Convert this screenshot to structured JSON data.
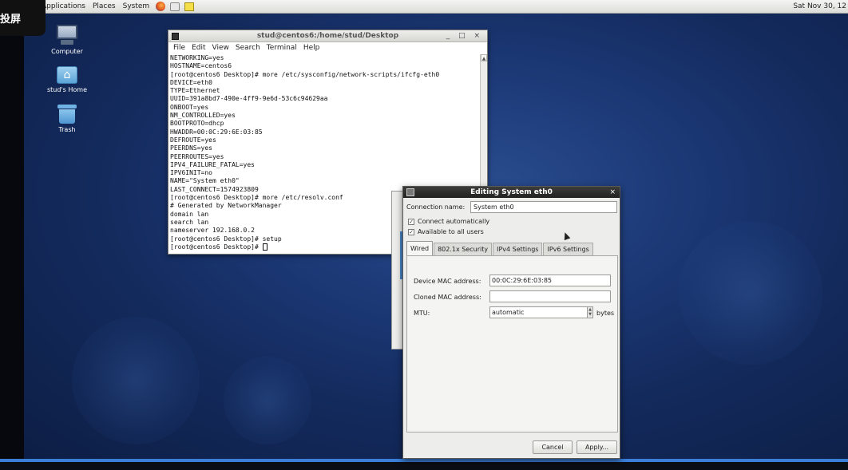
{
  "overlay": {
    "text": "投屏"
  },
  "top_panel": {
    "menus": [
      "Applications",
      "Places",
      "System"
    ],
    "launchers": [
      "firefox-icon",
      "mail-icon",
      "notes-icon"
    ],
    "clock": "Sat Nov 30, 12"
  },
  "desktop_icons": [
    {
      "label": "Computer",
      "icon": "computer-icon"
    },
    {
      "label": "stud's Home",
      "icon": "home-folder-icon"
    },
    {
      "label": "Trash",
      "icon": "trash-icon"
    }
  ],
  "terminal": {
    "title": "stud@centos6:/home/stud/Desktop",
    "window_controls": "_ □ ×",
    "menus": [
      "File",
      "Edit",
      "View",
      "Search",
      "Terminal",
      "Help"
    ],
    "lines": [
      "NETWORKING=yes",
      "HOSTNAME=centos6",
      "[root@centos6 Desktop]# more /etc/sysconfig/network-scripts/ifcfg-eth0",
      "DEVICE=eth0",
      "TYPE=Ethernet",
      "UUID=391a8bd7-490e-4ff9-9e6d-53c6c94629aa",
      "ONBOOT=yes",
      "NM_CONTROLLED=yes",
      "BOOTPROTO=dhcp",
      "HWADDR=00:0C:29:6E:03:85",
      "DEFROUTE=yes",
      "PEERDNS=yes",
      "PEERROUTES=yes",
      "IPV4_FAILURE_FATAL=yes",
      "IPV6INIT=no",
      "NAME=\"System eth0\"",
      "LAST_CONNECT=1574923809",
      "[root@centos6 Desktop]# more /etc/resolv.conf",
      "# Generated by NetworkManager",
      "domain lan",
      "search lan",
      "nameserver 192.168.0.2",
      "[root@centos6 Desktop]# setup"
    ],
    "prompt": "[root@centos6 Desktop]# "
  },
  "dialog": {
    "title": "Editing System eth0",
    "close": "×",
    "connection_name_label": "Connection name:",
    "connection_name_value": "System eth0",
    "connect_automatically": {
      "label": "Connect automatically",
      "checked": true
    },
    "available_to_all_users": {
      "label": "Available to all users",
      "checked": true
    },
    "tabs": [
      "Wired",
      "802.1x Security",
      "IPv4 Settings",
      "IPv6 Settings"
    ],
    "active_tab": "Wired",
    "fields": {
      "device_mac_label": "Device MAC address:",
      "device_mac_value": "00:0C:29:6E:03:85",
      "cloned_mac_label": "Cloned MAC address:",
      "cloned_mac_value": "",
      "mtu_label": "MTU:",
      "mtu_value": "automatic",
      "mtu_unit": "bytes"
    },
    "buttons": {
      "cancel": "Cancel",
      "apply": "Apply..."
    }
  },
  "colors": {
    "desktop_blue": "#1b3774",
    "bottom_accent": "#3b7fd9",
    "dialog_titlebar": "#2c2c2a"
  }
}
